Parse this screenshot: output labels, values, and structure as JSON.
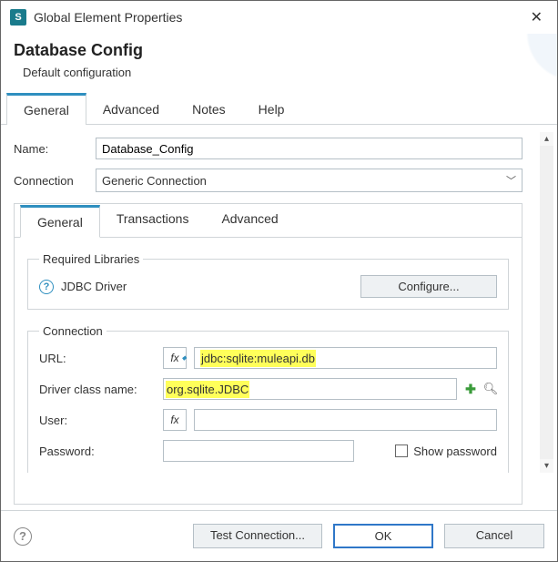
{
  "window": {
    "title": "Global Element Properties",
    "close_icon": "close-icon"
  },
  "header": {
    "title": "Database Config",
    "subtitle": "Default configuration"
  },
  "tabs": {
    "items": [
      "General",
      "Advanced",
      "Notes",
      "Help"
    ],
    "active": 0
  },
  "form": {
    "name_label": "Name:",
    "name_value": "Database_Config",
    "connection_label": "Connection",
    "connection_value": "Generic Connection"
  },
  "innerTabs": {
    "items": [
      "General",
      "Transactions",
      "Advanced"
    ],
    "active": 0
  },
  "requiredLibraries": {
    "legend": "Required Libraries",
    "driver_label": "JDBC Driver",
    "configure_label": "Configure..."
  },
  "connection": {
    "legend": "Connection",
    "url_label": "URL:",
    "url_value": "jdbc:sqlite:muleapi.db",
    "driver_class_label": "Driver class name:",
    "driver_class_value": "org.sqlite.JDBC",
    "user_label": "User:",
    "user_value": "",
    "password_label": "Password:",
    "password_value": "",
    "show_password_label": "Show password"
  },
  "footer": {
    "test_label": "Test Connection...",
    "ok_label": "OK",
    "cancel_label": "Cancel"
  },
  "icons": {
    "fx": "fx"
  }
}
